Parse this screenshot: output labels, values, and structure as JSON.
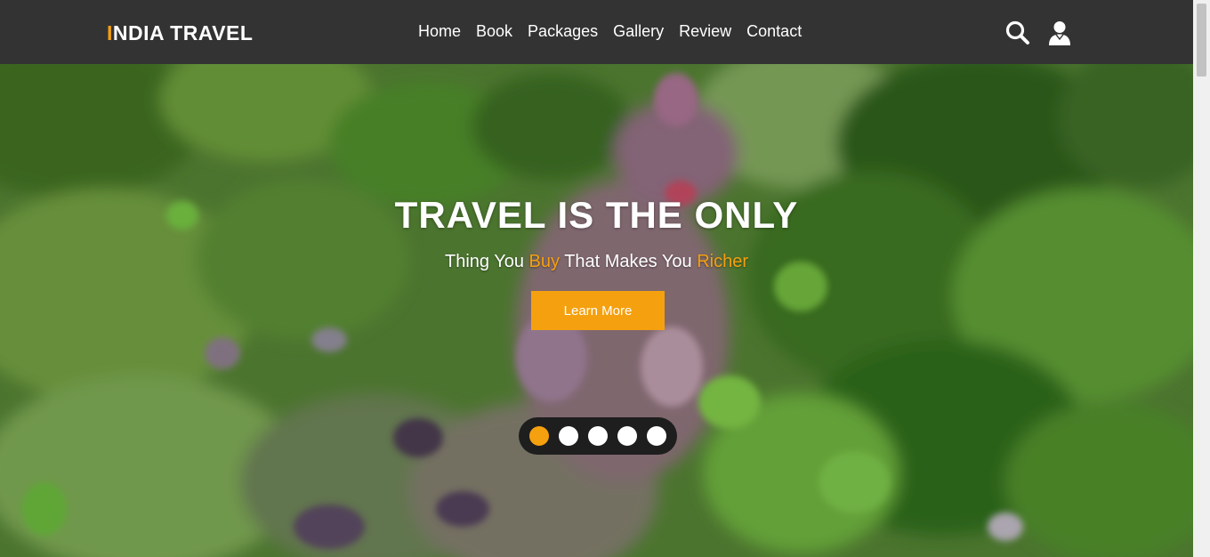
{
  "brand": {
    "logo_first_letter": "I",
    "logo_rest": "NDIA TRAVEL",
    "accent_color": "#f5a00f",
    "header_bg": "#333333"
  },
  "nav": {
    "items": [
      "Home",
      "Book",
      "Packages",
      "Gallery",
      "Review",
      "Contact"
    ]
  },
  "header_icons": {
    "search": "search-icon",
    "user": "user-icon"
  },
  "hero": {
    "title": "TRAVEL IS THE ONLY",
    "subtitle_1": "Thing You ",
    "subtitle_hl_1": "Buy",
    "subtitle_2": " That Makes You ",
    "subtitle_hl_2": "Richer",
    "cta_label": "Learn More"
  },
  "slider": {
    "count": 5,
    "active_index": 0
  }
}
